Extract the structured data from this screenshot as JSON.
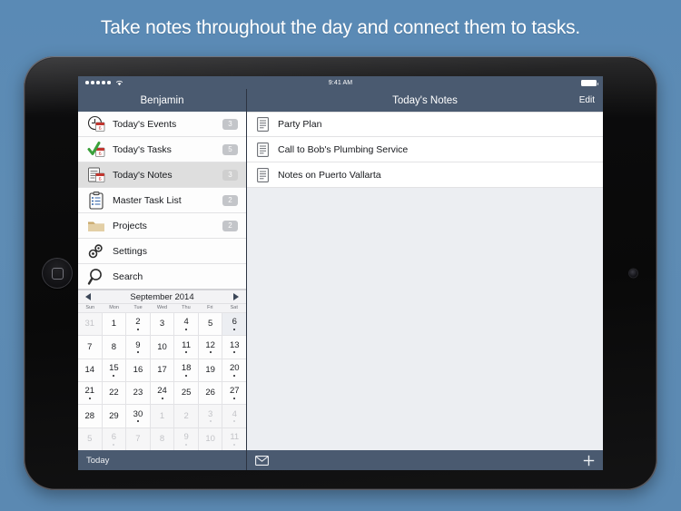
{
  "headline": "Take notes throughout the day and connect them to tasks.",
  "colors": {
    "page_background": "#5b89b2",
    "navbar": "#4a5a70",
    "selected_row": "#dedede",
    "badge": "#c3c5c9",
    "accent_green": "#3aa03a",
    "accent_red": "#c2352e"
  },
  "status_bar": {
    "signal_dots": 5,
    "wifi_icon": "wifi-icon",
    "time": "9:41 AM",
    "battery_icon": "battery-full-icon"
  },
  "sidebar": {
    "title": "Benjamin",
    "items": [
      {
        "label": "Today's Events",
        "badge": "3",
        "icon": "clock-calendar-icon",
        "selected": false
      },
      {
        "label": "Today's Tasks",
        "badge": "5",
        "icon": "check-calendar-icon",
        "selected": false
      },
      {
        "label": "Today's Notes",
        "badge": "3",
        "icon": "note-calendar-icon",
        "selected": true
      },
      {
        "label": "Master Task List",
        "badge": "2",
        "icon": "clipboard-icon",
        "selected": false
      },
      {
        "label": "Projects",
        "badge": "2",
        "icon": "folder-icon",
        "selected": false
      },
      {
        "label": "Settings",
        "badge": "",
        "icon": "gears-icon",
        "selected": false
      },
      {
        "label": "Search",
        "badge": "",
        "icon": "magnifier-icon",
        "selected": false
      }
    ],
    "toolbar": {
      "today_label": "Today"
    }
  },
  "calendar": {
    "month_label": "September 2014",
    "prev_icon": "chevron-left-icon",
    "next_icon": "chevron-right-icon",
    "day_names": [
      "Sun",
      "Mon",
      "Tue",
      "Wed",
      "Thu",
      "Fri",
      "Sat"
    ],
    "weeks": [
      [
        {
          "n": "31",
          "out": true,
          "dot": false,
          "today": false
        },
        {
          "n": "1",
          "out": false,
          "dot": false,
          "today": false
        },
        {
          "n": "2",
          "out": false,
          "dot": true,
          "today": false
        },
        {
          "n": "3",
          "out": false,
          "dot": false,
          "today": false
        },
        {
          "n": "4",
          "out": false,
          "dot": true,
          "today": false
        },
        {
          "n": "5",
          "out": false,
          "dot": false,
          "today": false
        },
        {
          "n": "6",
          "out": false,
          "dot": true,
          "today": true
        }
      ],
      [
        {
          "n": "7",
          "out": false,
          "dot": false,
          "today": false
        },
        {
          "n": "8",
          "out": false,
          "dot": false,
          "today": false
        },
        {
          "n": "9",
          "out": false,
          "dot": true,
          "today": false
        },
        {
          "n": "10",
          "out": false,
          "dot": false,
          "today": false
        },
        {
          "n": "11",
          "out": false,
          "dot": true,
          "today": false
        },
        {
          "n": "12",
          "out": false,
          "dot": true,
          "today": false
        },
        {
          "n": "13",
          "out": false,
          "dot": true,
          "today": false
        }
      ],
      [
        {
          "n": "14",
          "out": false,
          "dot": false,
          "today": false
        },
        {
          "n": "15",
          "out": false,
          "dot": true,
          "today": false
        },
        {
          "n": "16",
          "out": false,
          "dot": false,
          "today": false
        },
        {
          "n": "17",
          "out": false,
          "dot": false,
          "today": false
        },
        {
          "n": "18",
          "out": false,
          "dot": true,
          "today": false
        },
        {
          "n": "19",
          "out": false,
          "dot": false,
          "today": false
        },
        {
          "n": "20",
          "out": false,
          "dot": true,
          "today": false
        }
      ],
      [
        {
          "n": "21",
          "out": false,
          "dot": true,
          "today": false
        },
        {
          "n": "22",
          "out": false,
          "dot": false,
          "today": false
        },
        {
          "n": "23",
          "out": false,
          "dot": false,
          "today": false
        },
        {
          "n": "24",
          "out": false,
          "dot": true,
          "today": false
        },
        {
          "n": "25",
          "out": false,
          "dot": false,
          "today": false
        },
        {
          "n": "26",
          "out": false,
          "dot": false,
          "today": false
        },
        {
          "n": "27",
          "out": false,
          "dot": true,
          "today": false
        }
      ],
      [
        {
          "n": "28",
          "out": false,
          "dot": false,
          "today": false
        },
        {
          "n": "29",
          "out": false,
          "dot": false,
          "today": false
        },
        {
          "n": "30",
          "out": false,
          "dot": true,
          "today": false
        },
        {
          "n": "1",
          "out": true,
          "dot": false,
          "today": false
        },
        {
          "n": "2",
          "out": true,
          "dot": false,
          "today": false
        },
        {
          "n": "3",
          "out": true,
          "dot": true,
          "today": false
        },
        {
          "n": "4",
          "out": true,
          "dot": true,
          "today": false
        }
      ],
      [
        {
          "n": "5",
          "out": true,
          "dot": false,
          "today": false
        },
        {
          "n": "6",
          "out": true,
          "dot": true,
          "today": false
        },
        {
          "n": "7",
          "out": true,
          "dot": false,
          "today": false
        },
        {
          "n": "8",
          "out": true,
          "dot": false,
          "today": false
        },
        {
          "n": "9",
          "out": true,
          "dot": true,
          "today": false
        },
        {
          "n": "10",
          "out": true,
          "dot": false,
          "today": false
        },
        {
          "n": "11",
          "out": true,
          "dot": true,
          "today": false
        }
      ]
    ]
  },
  "detail": {
    "title": "Today's Notes",
    "edit_label": "Edit",
    "notes": [
      {
        "label": "Party Plan",
        "icon": "note-icon"
      },
      {
        "label": "Call to Bob's Plumbing Service",
        "icon": "note-icon"
      },
      {
        "label": "Notes on Puerto Vallarta",
        "icon": "note-icon"
      }
    ],
    "toolbar": {
      "mail_icon": "envelope-icon",
      "add_icon": "plus-icon"
    }
  }
}
